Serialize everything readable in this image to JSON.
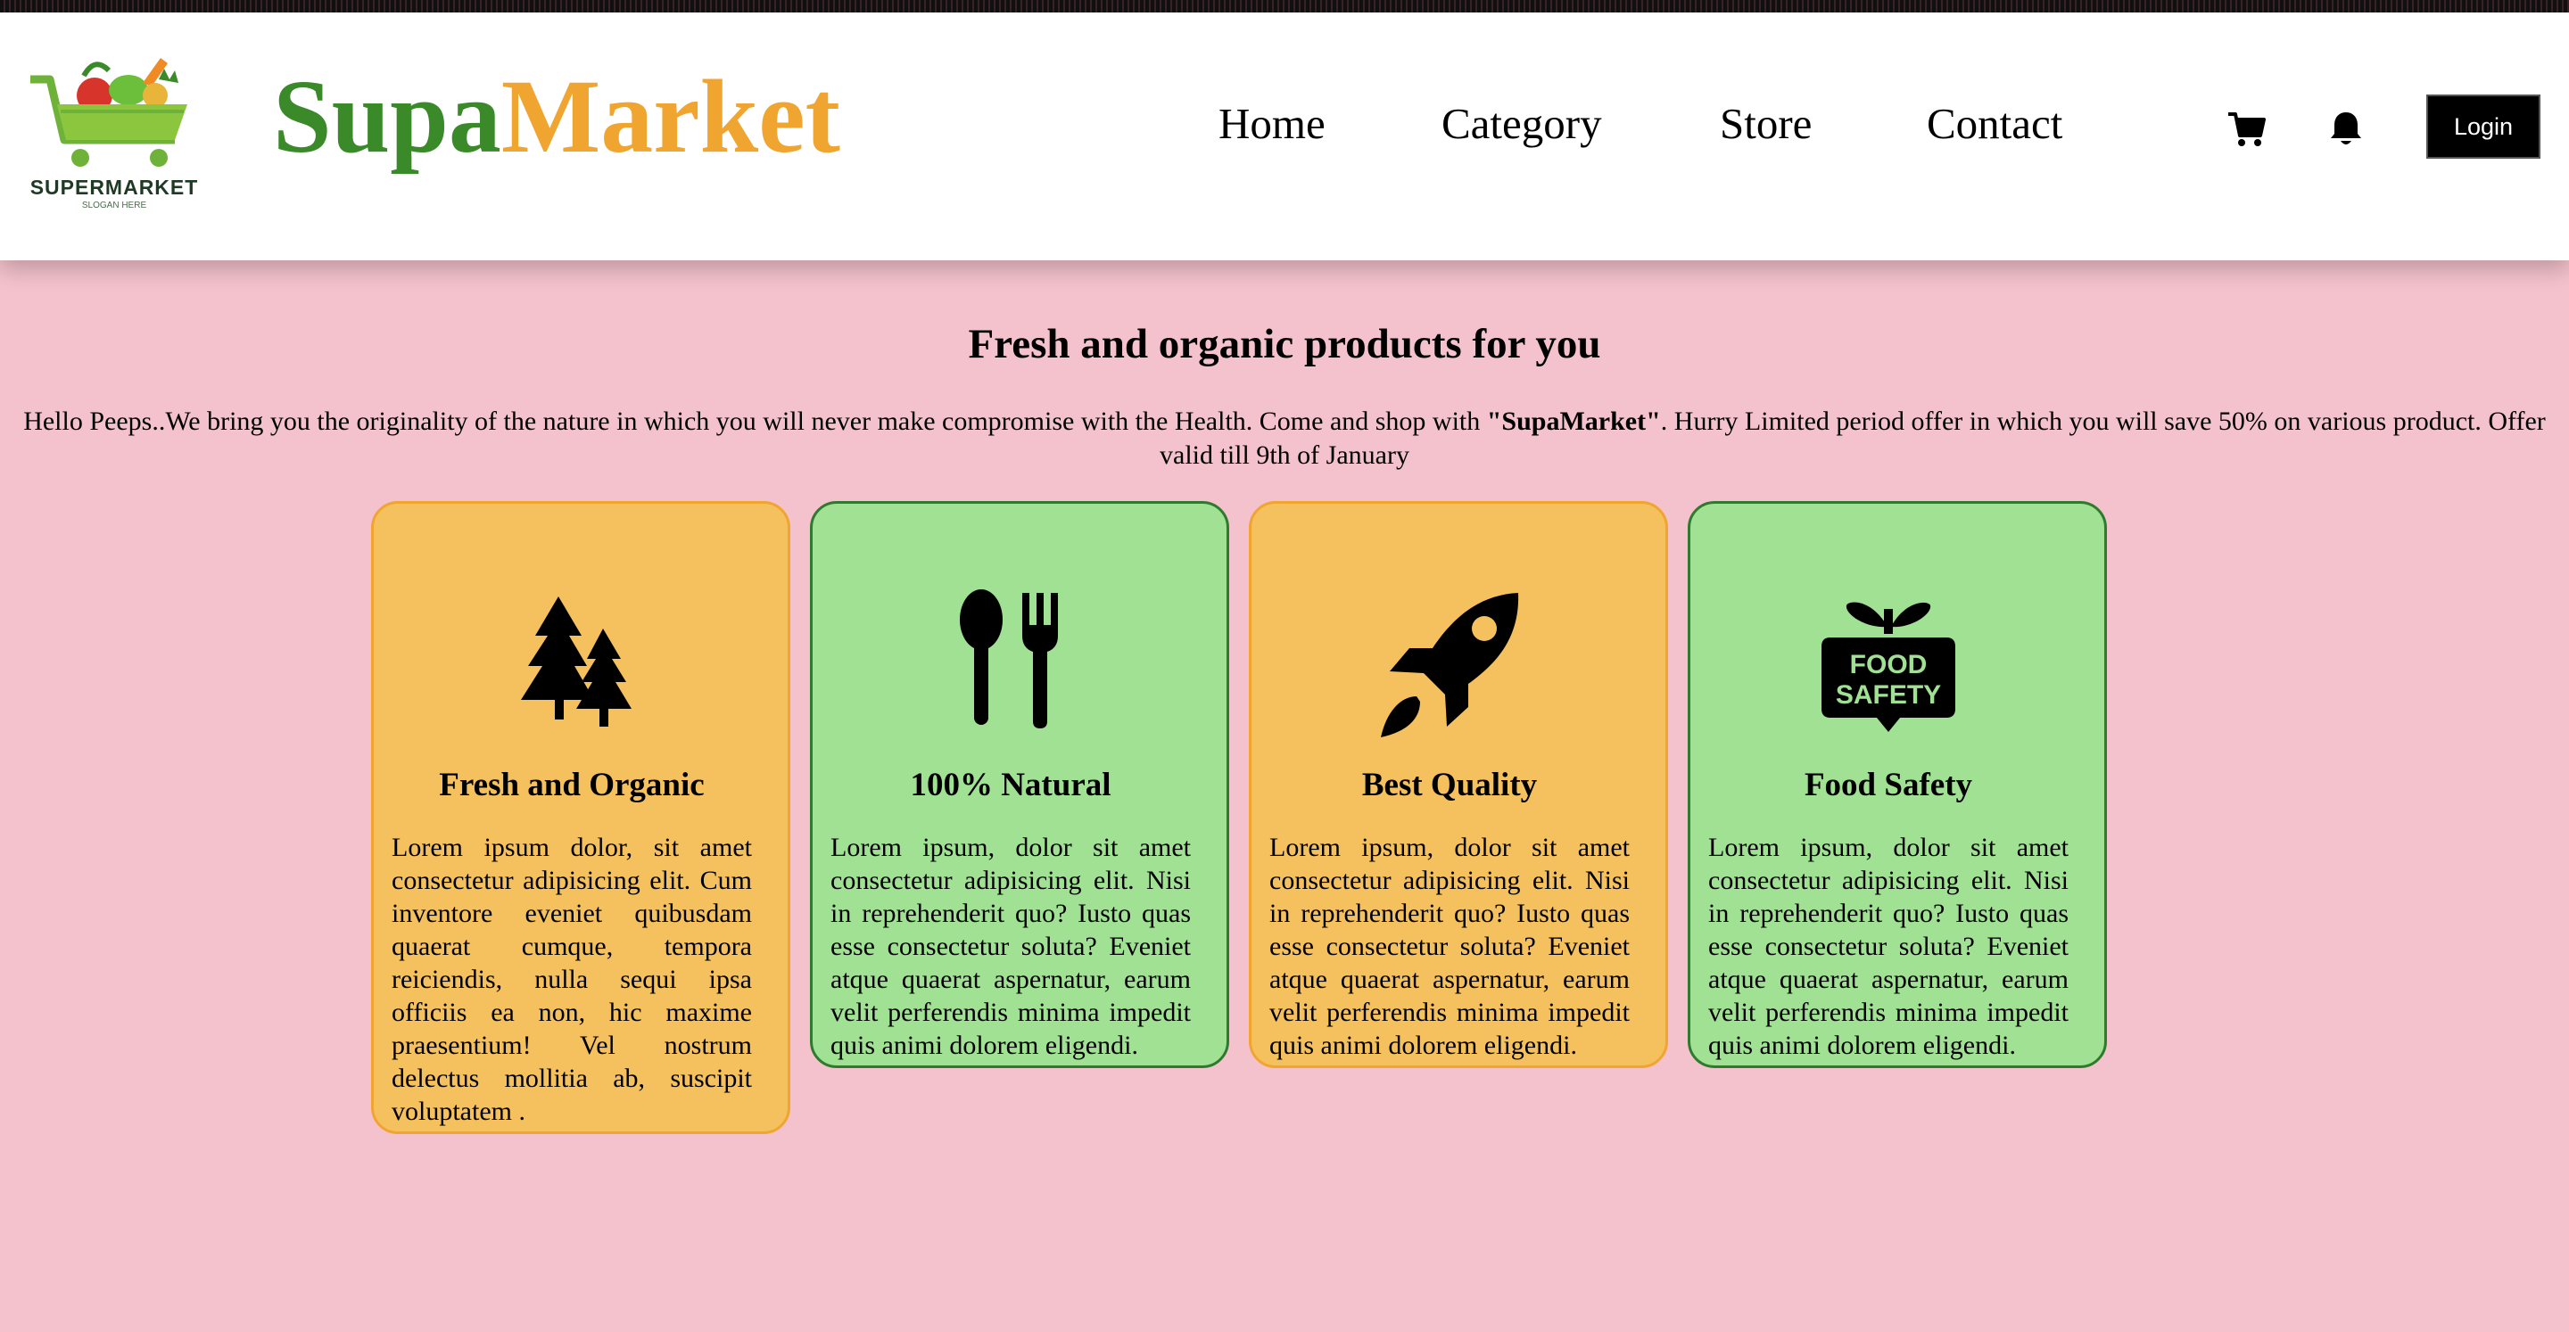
{
  "logo": {
    "name": "SUPERMARKET",
    "slogan": "SLOGAN HERE"
  },
  "brand": {
    "part1": "Supa",
    "part2": "Market"
  },
  "nav": [
    {
      "label": "Home"
    },
    {
      "label": "Category"
    },
    {
      "label": "Store"
    },
    {
      "label": "Contact"
    }
  ],
  "icons": {
    "cart": "shopping-cart-icon",
    "bell": "notification-bell-icon"
  },
  "login": {
    "label": "Login"
  },
  "hero": {
    "title": "Fresh and organic products for you",
    "intro_a": "Hello Peeps..We bring you the originality of the nature in which you will never make compromise with the Health. Come and shop with ",
    "intro_brand": "\"SupaMarket\"",
    "intro_b": ". Hurry Limited period offer in which you will save 50% on various product. Offer valid till 9th of January"
  },
  "cards": [
    {
      "icon": "trees-icon",
      "title": "Fresh and Organic",
      "text": "Lorem ipsum dolor, sit amet consectetur adipisicing elit. Cum inventore eveniet quibusdam quaerat cumque, tempora reiciendis, nulla sequi ipsa officiis ea non, hic maxime praesentium! Vel nostrum delectus mollitia ab, suscipit voluptatem ."
    },
    {
      "icon": "spoon-fork-icon",
      "title": "100% Natural",
      "text": "Lorem ipsum, dolor sit amet consectetur adipisicing elit. Nisi in reprehenderit quo? Iusto quas esse consectetur soluta? Eveniet atque quaerat aspernatur, earum velit perferendis minima impedit quis animi dolorem eligendi."
    },
    {
      "icon": "rocket-icon",
      "title": "Best Quality",
      "text": "Lorem ipsum, dolor sit amet consectetur adipisicing elit. Nisi in reprehenderit quo? Iusto quas esse consectetur soluta? Eveniet atque quaerat aspernatur, earum velit perferendis minima impedit quis animi dolorem eligendi."
    },
    {
      "icon": "food-safety-icon",
      "title": "Food Safety",
      "badge": "FOOD SAFETY",
      "text": "Lorem ipsum, dolor sit amet consectetur adipisicing elit. Nisi in reprehenderit quo? Iusto quas esse consectetur soluta? Eveniet atque quaerat aspernatur, earum velit perferendis minima impedit quis animi dolorem eligendi."
    }
  ],
  "colors": {
    "background": "#f4c2cc",
    "brand_green": "#3a8a2a",
    "brand_orange": "#f0a531",
    "card_orange": "#f5c15f",
    "card_green": "#a0e194"
  }
}
